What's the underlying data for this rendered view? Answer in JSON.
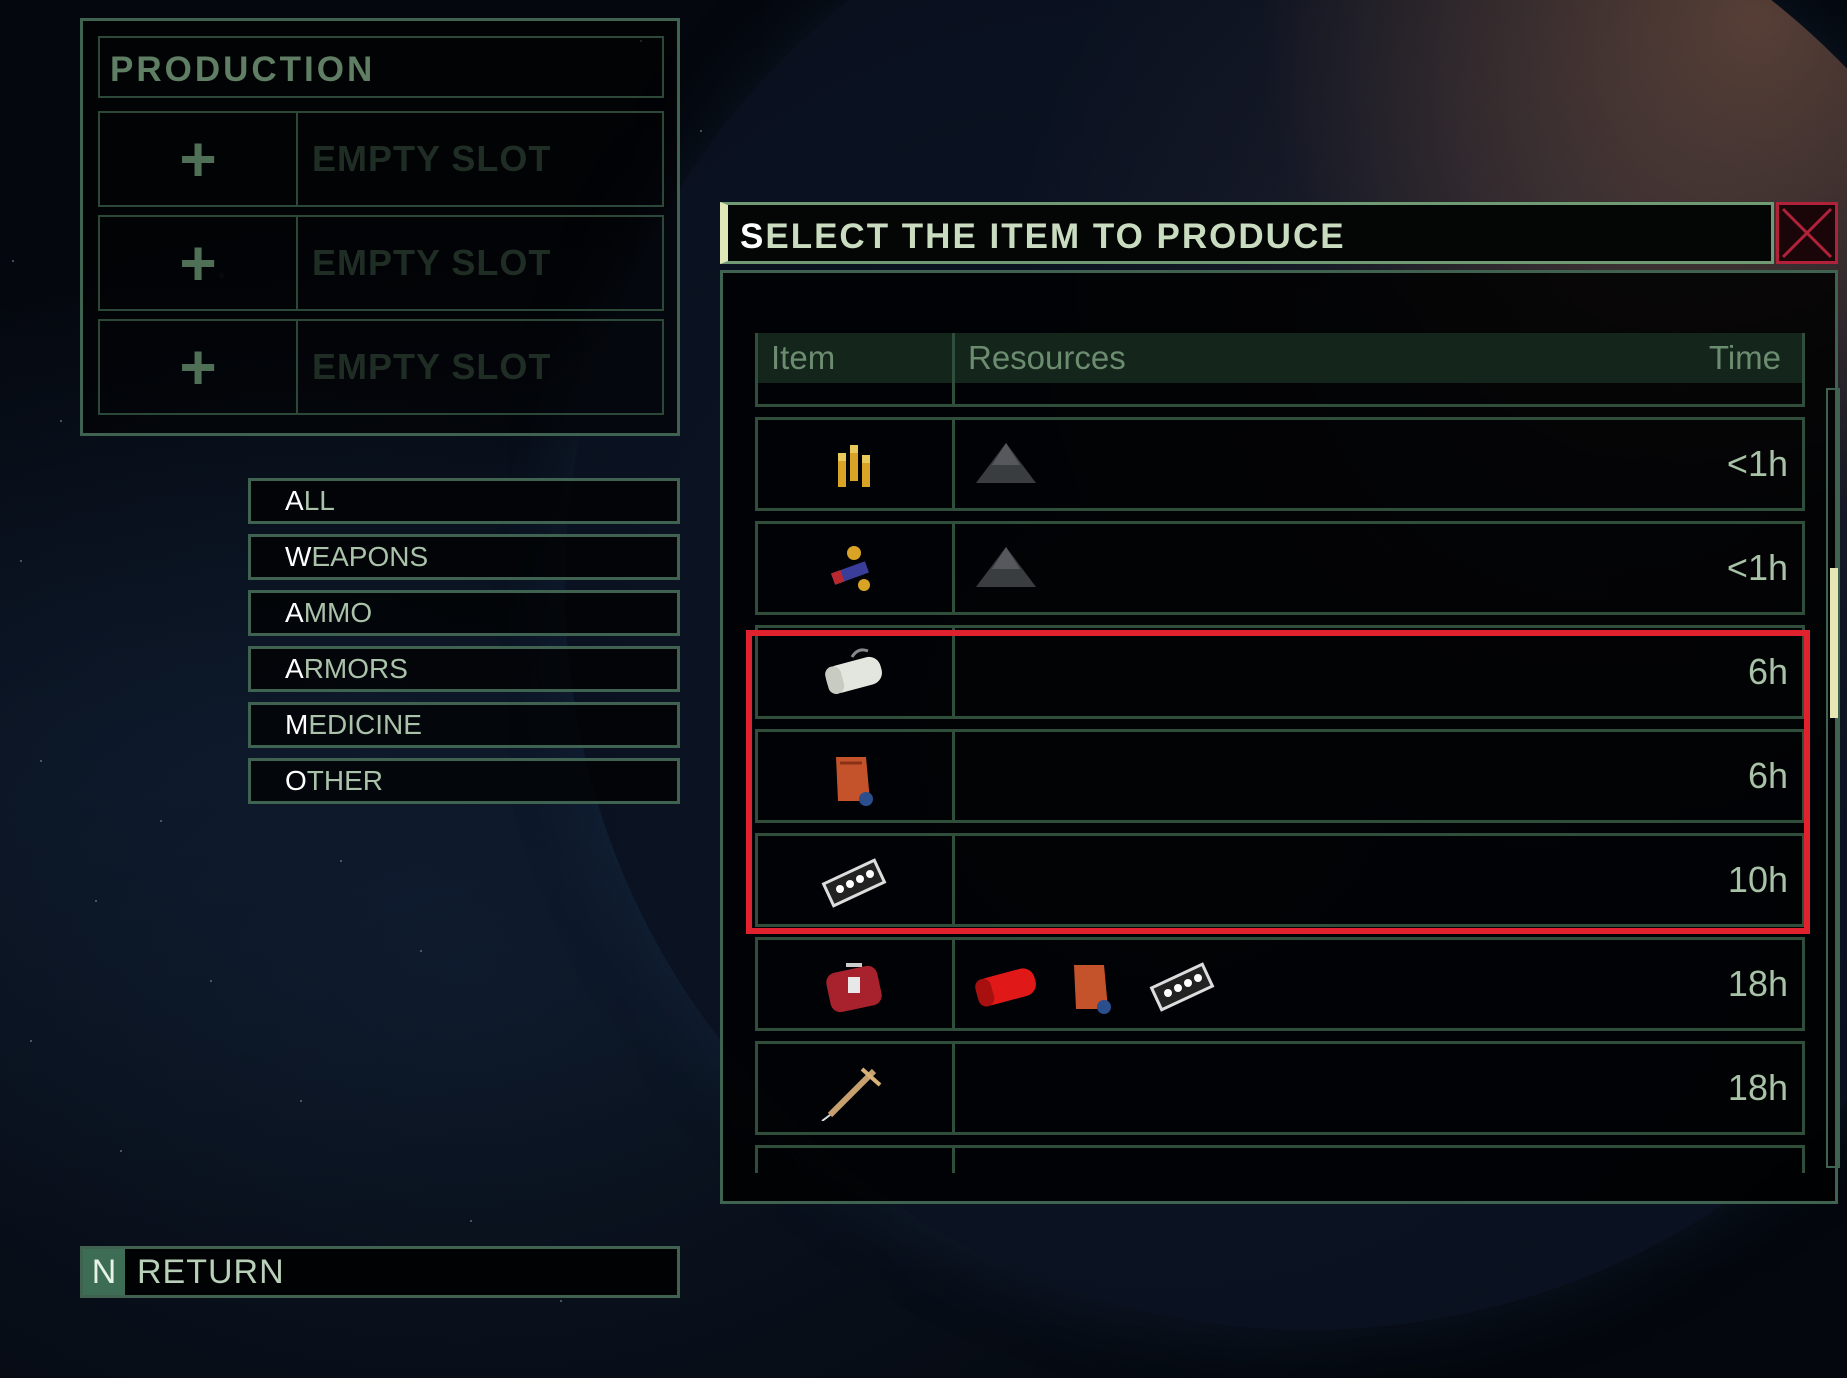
{
  "production": {
    "title": "PRODUCTION",
    "slots": [
      {
        "label": "EMPTY SLOT"
      },
      {
        "label": "EMPTY SLOT"
      },
      {
        "label": "EMPTY SLOT"
      }
    ]
  },
  "categories": [
    {
      "first": "A",
      "rest": "LL"
    },
    {
      "first": "W",
      "rest": "EAPONS"
    },
    {
      "first": "A",
      "rest": "MMO"
    },
    {
      "first": "A",
      "rest": "RMORS"
    },
    {
      "first": "M",
      "rest": "EDICINE"
    },
    {
      "first": "O",
      "rest": "THER"
    }
  ],
  "return_button": {
    "key": "N",
    "label": "RETURN"
  },
  "dialog": {
    "title_first": "S",
    "title_rest": "ELECT THE ITEM TO PRODUCE",
    "columns": {
      "item": "Item",
      "resources": "Resources",
      "time": "Time"
    },
    "rows": [
      {
        "item_icon": "bullets-icon",
        "resources": [
          "gunpowder-icon"
        ],
        "time": "<1h"
      },
      {
        "item_icon": "shells-icon",
        "resources": [
          "gunpowder-icon"
        ],
        "time": "<1h"
      },
      {
        "item_icon": "bandage-icon",
        "resources": [],
        "time": "6h"
      },
      {
        "item_icon": "tourniquet-icon",
        "resources": [],
        "time": "6h"
      },
      {
        "item_icon": "pills-icon",
        "resources": [],
        "time": "10h"
      },
      {
        "item_icon": "medkit-icon",
        "resources": [
          "red-bandage-icon",
          "tourniquet-icon",
          "pills-icon"
        ],
        "time": "18h"
      },
      {
        "item_icon": "syringe-icon",
        "resources": [],
        "time": "18h"
      }
    ]
  },
  "colors": {
    "highlight": "#e0222e",
    "accent": "#3f6350",
    "close": "#b0213a"
  }
}
